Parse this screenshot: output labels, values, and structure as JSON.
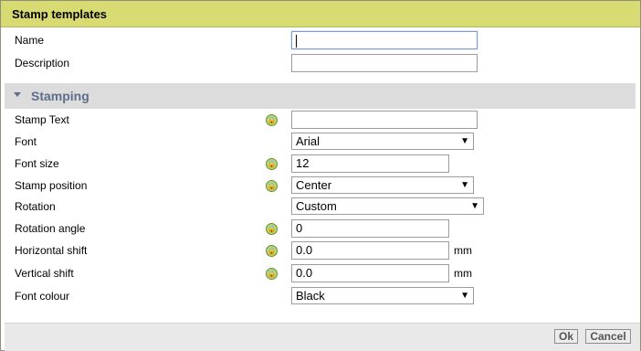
{
  "dialog": {
    "title": "Stamp templates"
  },
  "general": {
    "name_label": "Name",
    "name_value": "",
    "description_label": "Description",
    "description_value": ""
  },
  "section": {
    "title": "Stamping"
  },
  "fields": {
    "stamp_text": {
      "label": "Stamp Text",
      "value": ""
    },
    "font": {
      "label": "Font",
      "value": "Arial"
    },
    "font_size": {
      "label": "Font size",
      "value": "12"
    },
    "stamp_position": {
      "label": "Stamp position",
      "value": "Center"
    },
    "rotation": {
      "label": "Rotation",
      "value": "Custom"
    },
    "rotation_angle": {
      "label": "Rotation angle",
      "value": "0"
    },
    "horizontal_shift": {
      "label": "Horizontal shift",
      "value": "0.0",
      "unit": "mm"
    },
    "vertical_shift": {
      "label": "Vertical shift",
      "value": "0.0",
      "unit": "mm"
    },
    "font_colour": {
      "label": "Font colour",
      "value": "Black"
    }
  },
  "buttons": {
    "ok": "Ok",
    "cancel": "Cancel"
  },
  "colors": {
    "titlebar": "#d8db72",
    "section_title": "#5e6e8a",
    "lock_icon": "#b8d77a"
  },
  "icons": {
    "lock": "lock-icon",
    "dropdown": "chevron-down-icon",
    "collapse": "triangle-down-icon"
  }
}
